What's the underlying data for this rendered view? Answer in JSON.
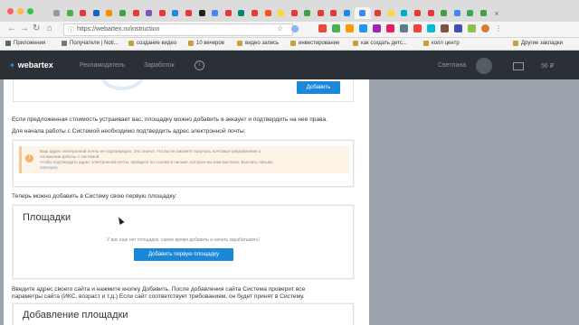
{
  "browser": {
    "url": "https://webartex.ru/instruction",
    "bookmarks": [
      {
        "label": "Приложения",
        "color": "#5f6368"
      },
      {
        "label": "Получатели | Noti...",
        "color": "#777"
      },
      {
        "label": "создание видео",
        "color": "#c7a23a"
      },
      {
        "label": "10 вечеров",
        "color": "#c7a23a"
      },
      {
        "label": "видео запись",
        "color": "#c7a23a"
      },
      {
        "label": "инвестирование",
        "color": "#c7a23a"
      },
      {
        "label": "как создать детс...",
        "color": "#c7a23a"
      },
      {
        "label": "колл центр",
        "color": "#c7a23a"
      },
      {
        "label": "Другие закладки",
        "color": "#c7a23a"
      }
    ]
  },
  "site": {
    "logo": "webartex",
    "nav": [
      "Рекламодатель",
      "Заработок"
    ],
    "username": "Светлана",
    "balance": "56 ₽",
    "help_symbol": "i"
  },
  "content": {
    "add_button": "Добавить",
    "para_price": "Если предложенная стоимость устраивает вас, площадку можно добавить в аккаунт и подтвердить на нее права.",
    "para_email": "Для начала работы с Системой необходимо подтвердить адрес электронной почты:",
    "warning_lines": [
      "Ваш адрес электронной почты не подтвержден. Это значит, что вы не сможете получать почтовые уведомления о",
      "положении работы с системой.",
      "Чтобы подтвердить адрес электронной почты, пройдите по ссылке в письме, которое мы вам выслали. Выслать письмо",
      "повторно"
    ],
    "para_add_site": "Теперь можно добавить в Систему свою первую площадку:",
    "sites_title": "Площадки",
    "sites_empty": "У вас еще нет площадок, самое время добавить и начать зарабатывать!",
    "add_first_site_button": "Добавить первую площадку",
    "para_enter_address_1": "Введите адрес своего сайта и нажмите кнопку Добавить. После добавления сайта Система проверит все",
    "para_enter_address_2": "параметры сайта (ИКС, возраст и т.д.) Если сайт соответствует требованиям, он будет принят в Систему.",
    "add_site_title": "Добавление площадки"
  },
  "colors": {
    "accent": "#1a87d8",
    "header_bg": "#2b3036",
    "warning_bg": "#fdf3e6",
    "warning_border": "#f6c894"
  }
}
